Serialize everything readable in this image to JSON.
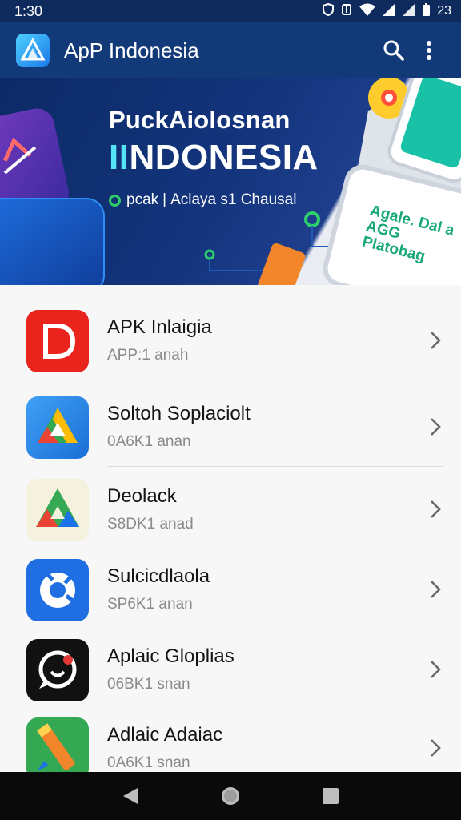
{
  "status_bar": {
    "time": "1:30",
    "battery_text": "23",
    "icons": [
      "shield-icon",
      "settings-icon",
      "wifi-icon",
      "signal-icon",
      "signal-icon",
      "battery-icon"
    ]
  },
  "app_bar": {
    "title": "ApP Indonesia",
    "logo_icon": "app-logo-icon",
    "actions": [
      "search-icon",
      "more-vert-icon"
    ]
  },
  "banner": {
    "title_line1": "PuckAiolosnan",
    "title_line2_prefix": "II",
    "title_line2": "NDONESIA",
    "subtitle_left": "pcak",
    "subtitle_separator": "|",
    "subtitle_right": "Aclaya s1 Chausal",
    "phone_text": "Agale. Dal a AGG Platobag"
  },
  "apps": [
    {
      "name": "APK Inlaigia",
      "subtitle": "APP:1 anah",
      "icon": "letter-d-icon",
      "color": "#e8241c"
    },
    {
      "name": "Soltoh Soplaciolt",
      "subtitle": "0A6K1 anan",
      "icon": "triangle-drive-icon",
      "color": "#2f8fe6"
    },
    {
      "name": "Deolack",
      "subtitle": "S8DK1 anad",
      "icon": "triangle-drive-icon",
      "color": "#f4f1df"
    },
    {
      "name": "Sulcicdlaola",
      "subtitle": "SP6K1 anan",
      "icon": "camera-shutter-icon",
      "color": "#1f6fe3"
    },
    {
      "name": "Aplaic Gloplias",
      "subtitle": "06BK1 snan",
      "icon": "chat-bubble-icon",
      "color": "#111111"
    },
    {
      "name": "Adlaic Adaiac",
      "subtitle": "0A6K1 snan",
      "icon": "pencil-icon",
      "color": "#34a853"
    }
  ],
  "nav_bar": [
    "back-icon",
    "home-icon",
    "recents-icon"
  ],
  "colors": {
    "status_bar": "#0f2a5c",
    "app_bar": "#133a78",
    "accent_cyan": "#55e3f8",
    "accent_green": "#2ccf6a"
  }
}
